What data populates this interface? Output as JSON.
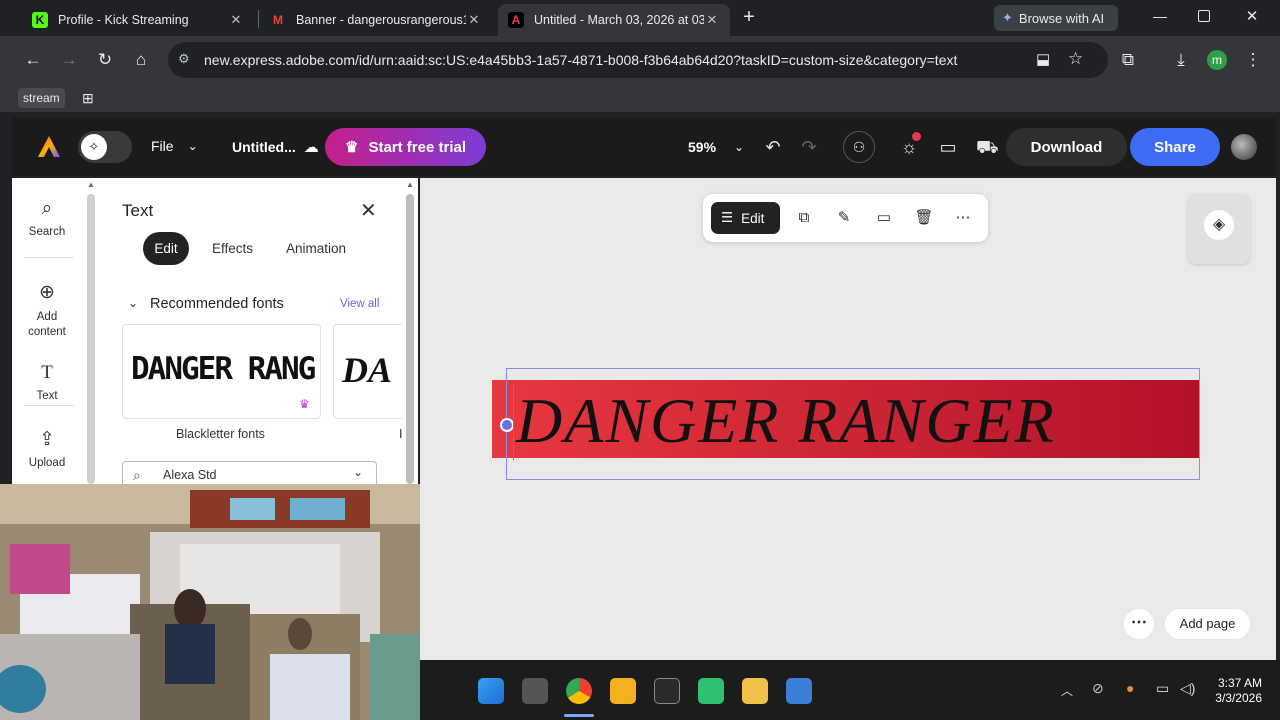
{
  "browser": {
    "tabs": [
      {
        "title": "Profile - Kick Streaming",
        "favicon": "K",
        "favicon_color": "#53fc18",
        "active": false
      },
      {
        "title": "Banner - dangerousrangerous1",
        "favicon": "M",
        "favicon_color": "#ea4335",
        "active": false
      },
      {
        "title": "Untitled - March 03, 2026 at 03",
        "favicon": "A",
        "favicon_color": "#e8384f",
        "active": true
      }
    ],
    "new_tab": "+",
    "browse_ai": "Browse with AI",
    "url": "new.express.adobe.com/id/urn:aaid:sc:US:e4a45bb3-1a57-4871-b008-f3b64ab64d20?taskID=custom-size&category=text",
    "profile_initial": "m",
    "bookmarks": [
      {
        "label": "stream"
      }
    ]
  },
  "app": {
    "file_label": "File",
    "doc_title": "Untitled...",
    "trial_label": "Start free trial",
    "zoom": "59%",
    "download_label": "Download",
    "share_label": "Share",
    "accent": "#1473e6",
    "trial_gradient_start": "#c51f8b",
    "trial_gradient_end": "#7d3cd6"
  },
  "rail": {
    "items": [
      {
        "label": "Search",
        "icon": "search-icon"
      },
      {
        "label": "Add content",
        "icon": "add-icon"
      },
      {
        "label": "Text",
        "icon": "text-icon"
      },
      {
        "label": "Upload",
        "icon": "upload-icon"
      }
    ]
  },
  "panel": {
    "title": "Text",
    "tabs": [
      {
        "label": "Edit",
        "active": true
      },
      {
        "label": "Effects",
        "active": false
      },
      {
        "label": "Animation",
        "active": false
      }
    ],
    "section_title": "Recommended fonts",
    "view_all": "View all",
    "font_cards": [
      {
        "preview": "DANGER RANG",
        "caption": "Blackletter fonts",
        "premium": true
      },
      {
        "preview": "DA",
        "caption": "I",
        "premium": false
      }
    ],
    "font_search_value": "Alexa Std"
  },
  "canvas": {
    "edit_label": "Edit",
    "banner_text": "DANGER RANGER",
    "banner_color_start": "#e8383f",
    "banner_color_end": "#b1122a",
    "add_page_label": "Add page"
  },
  "taskbar": {
    "time": "3:37 AM",
    "date": "3/3/2026"
  }
}
